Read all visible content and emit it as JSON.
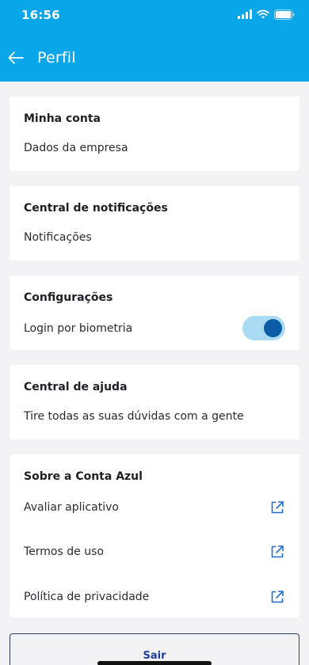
{
  "status_bar": {
    "time": "16:56",
    "icons": [
      "signal-icon",
      "wifi-icon",
      "battery-icon"
    ]
  },
  "header": {
    "title": "Perfil",
    "back_icon": "arrow-left-icon",
    "background": "#0aa6ea"
  },
  "sections": {
    "minha_conta": {
      "title": "Minha conta",
      "item": "Dados da empresa"
    },
    "notificacoes": {
      "title": "Central de notificações",
      "item": "Notificações"
    },
    "configuracoes": {
      "title": "Configurações",
      "item": "Login por biometria",
      "toggle_on": true
    },
    "ajuda": {
      "title": "Central de ajuda",
      "item": "Tire todas as suas dúvidas com a gente"
    },
    "sobre": {
      "title": "Sobre a Conta Azul",
      "items": [
        {
          "label": "Avaliar aplicativo",
          "icon": "external-link-icon"
        },
        {
          "label": "Termos de uso",
          "icon": "external-link-icon"
        },
        {
          "label": "Política de privacidade",
          "icon": "external-link-icon"
        }
      ]
    }
  },
  "logout": {
    "label": "Sair"
  },
  "colors": {
    "accent": "#0aa6ea",
    "toggle_track": "#a9dcf4",
    "toggle_knob": "#0b5da8",
    "link_icon": "#1b6fd6"
  }
}
